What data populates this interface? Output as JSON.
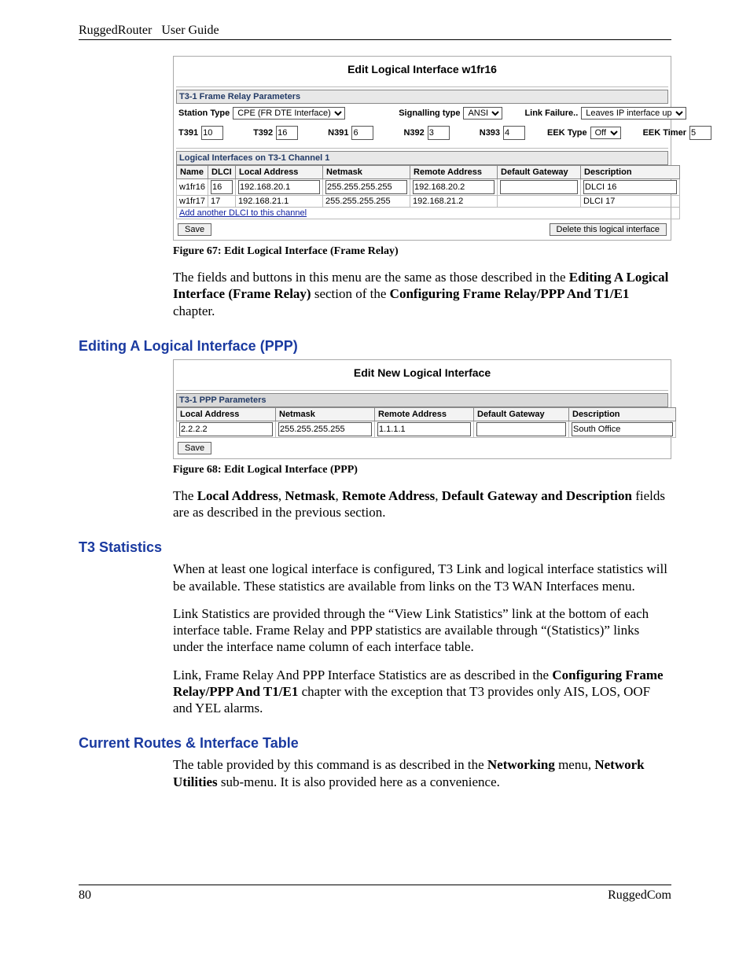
{
  "header": {
    "left": "RuggedRouter   User Guide"
  },
  "fig67": {
    "title": "Edit Logical Interface w1fr16",
    "section1": "T3-1 Frame Relay Parameters",
    "st_label": "Station Type",
    "st_value": "CPE (FR DTE Interface)",
    "sig_label": "Signalling type",
    "sig_value": "ANSI",
    "lf_label": "Link Failure..",
    "lf_value": "Leaves IP interface up",
    "t391l": "T391",
    "t391v": "10",
    "t392l": "T392",
    "t392v": "16",
    "n391l": "N391",
    "n391v": "6",
    "n392l": "N392",
    "n392v": "3",
    "n393l": "N393",
    "n393v": "4",
    "eekt_l": "EEK Type",
    "eekt_v": "Off",
    "eektm_l": "EEK Timer",
    "eektm_v": "5",
    "section2": "Logical Interfaces on T3-1 Channel 1",
    "cols": {
      "c1": "Name",
      "c2": "DLCI",
      "c3": "Local Address",
      "c4": "Netmask",
      "c5": "Remote Address",
      "c6": "Default Gateway",
      "c7": "Description"
    },
    "rows": [
      {
        "name": "w1fr16",
        "dlci": "16",
        "local": "192.168.20.1",
        "mask": "255.255.255.255",
        "remote": "192.168.20.2",
        "gw": "",
        "desc": "DLCI 16"
      },
      {
        "name": "w1fr17",
        "dlci": "17",
        "local": "192.168.21.1",
        "mask": "255.255.255.255",
        "remote": "192.168.21.2",
        "gw": "",
        "desc": "DLCI 17"
      }
    ],
    "addlink": "Add another DLCI to this channel",
    "save": "Save",
    "delete": "Delete this logical interface",
    "caption": "Figure 67: Edit Logical Interface (Frame Relay)"
  },
  "para1": {
    "p1a": "The fields and buttons in this menu are the same as those described in the ",
    "p1b": "Editing A Logical Interface (Frame Relay)",
    "p1c": " section of the ",
    "p1d": "Configuring Frame Relay/PPP And T1/E1",
    "p1e": " chapter."
  },
  "h_ppp": "Editing A Logical Interface (PPP)",
  "fig68": {
    "title": "Edit New Logical Interface",
    "section": "T3-1 PPP Parameters",
    "cols": {
      "c1": "Local Address",
      "c2": "Netmask",
      "c3": "Remote Address",
      "c4": "Default Gateway",
      "c5": "Description"
    },
    "row": {
      "local": "2.2.2.2",
      "mask": "255.255.255.255",
      "remote": "1.1.1.1",
      "gw": "",
      "desc": "South Office"
    },
    "save": "Save",
    "caption": "Figure 68: Edit Logical Interface (PPP)"
  },
  "para2": {
    "a": "The ",
    "b": "Local Address",
    "c": ", ",
    "d": "Netmask",
    "e": ", ",
    "f": "Remote Address",
    "g": ", ",
    "h": "Default Gateway and Description",
    "i": " fields are as described in the previous section."
  },
  "h_t3": "T3 Statistics",
  "t3p1": "When at least one logical interface is configured, T3 Link and logical interface statistics will be available.  These statistics are available from links on the T3 WAN Interfaces menu.",
  "t3p2": "Link Statistics are provided through the “View Link Statistics” link at the bottom of each interface table.  Frame Relay and PPP statistics are available through “(Statistics)” links under the interface name column of each interface table.",
  "t3p3a": "Link, Frame Relay And PPP Interface Statistics are as described in the ",
  "t3p3b": "Configuring Frame Relay/PPP And T1/E1",
  "t3p3c": " chapter with the exception that T3 provides only AIS, LOS, OOF and YEL alarms.",
  "h_routes": "Current Routes & Interface Table",
  "routes_a": "The table provided by this command is as described in the ",
  "routes_b": "Networking",
  "routes_c": " menu, ",
  "routes_d": "Network Utilities",
  "routes_e": " sub-menu.  It is also provided here as a convenience.",
  "footer": {
    "page": "80",
    "brand": "RuggedCom"
  }
}
